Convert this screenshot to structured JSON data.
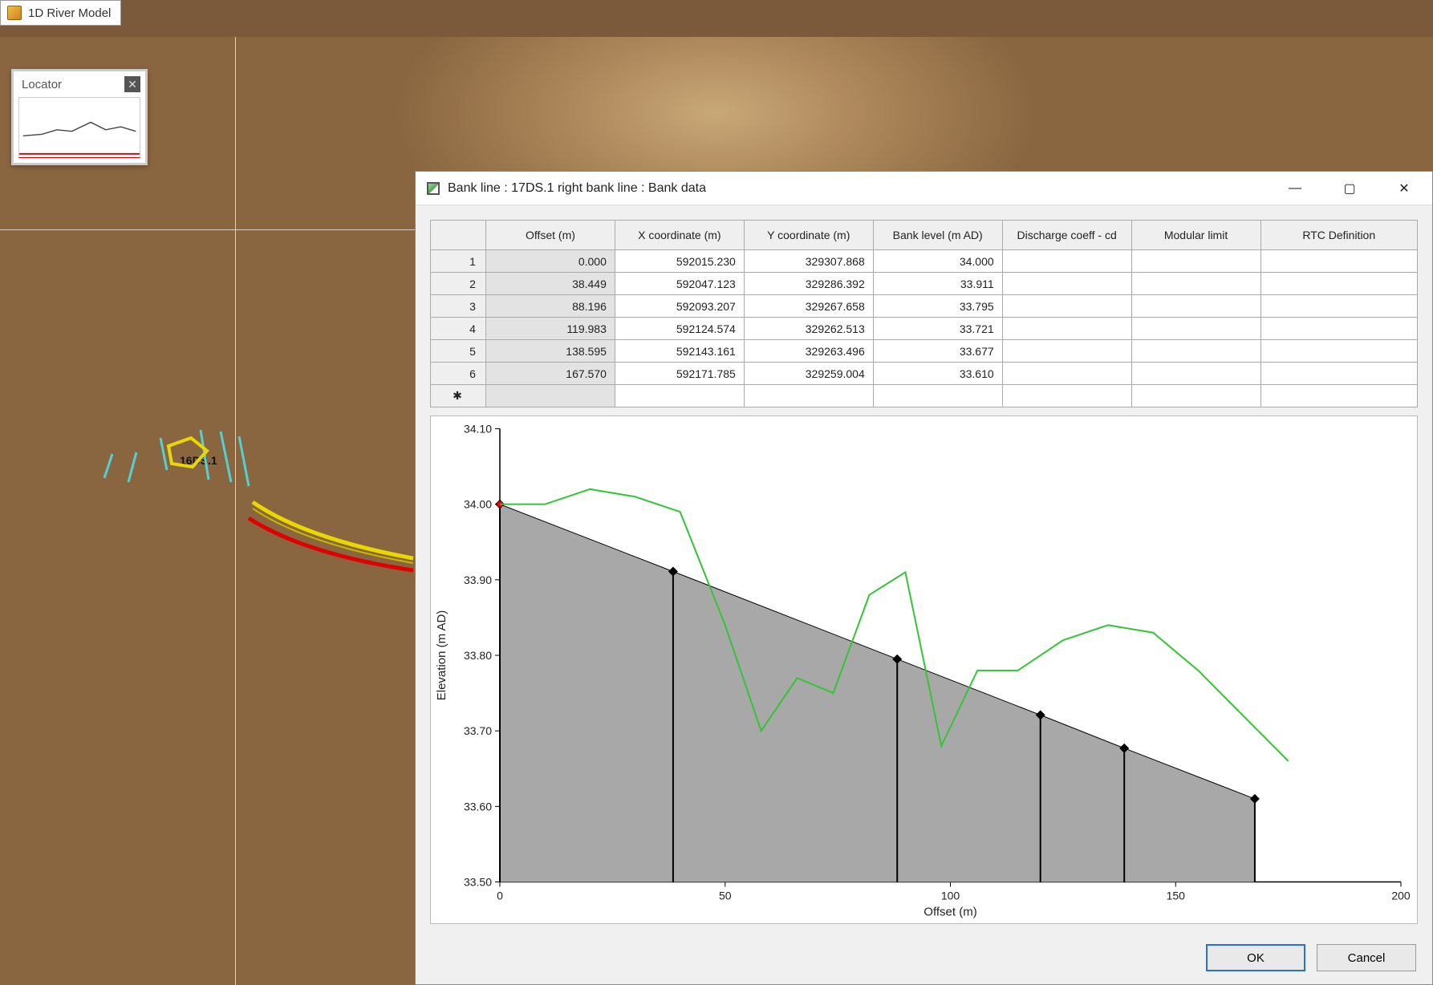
{
  "app": {
    "title": "1D River Model"
  },
  "locator": {
    "title": "Locator"
  },
  "map": {
    "node_label": "16DS.1"
  },
  "dialog": {
    "title": "Bank line : 17DS.1 right bank line : Bank data",
    "ok": "OK",
    "cancel": "Cancel",
    "columns": [
      "Offset (m)",
      "X coordinate (m)",
      "Y coordinate (m)",
      "Bank level (m AD)",
      "Discharge coeff - cd",
      "Modular limit",
      "RTC Definition"
    ],
    "rows": [
      {
        "n": "1",
        "offset": "0.000",
        "x": "592015.230",
        "y": "329307.868",
        "level": "34.000",
        "dc": "",
        "ml": "",
        "rtc": ""
      },
      {
        "n": "2",
        "offset": "38.449",
        "x": "592047.123",
        "y": "329286.392",
        "level": "33.911",
        "dc": "",
        "ml": "",
        "rtc": ""
      },
      {
        "n": "3",
        "offset": "88.196",
        "x": "592093.207",
        "y": "329267.658",
        "level": "33.795",
        "dc": "",
        "ml": "",
        "rtc": ""
      },
      {
        "n": "4",
        "offset": "119.983",
        "x": "592124.574",
        "y": "329262.513",
        "level": "33.721",
        "dc": "",
        "ml": "",
        "rtc": ""
      },
      {
        "n": "5",
        "offset": "138.595",
        "x": "592143.161",
        "y": "329263.496",
        "level": "33.677",
        "dc": "",
        "ml": "",
        "rtc": ""
      },
      {
        "n": "6",
        "offset": "167.570",
        "x": "592171.785",
        "y": "329259.004",
        "level": "33.610",
        "dc": "",
        "ml": "",
        "rtc": ""
      }
    ]
  },
  "chart_data": {
    "type": "line",
    "xlabel": "Offset (m)",
    "ylabel": "Elevation (m AD)",
    "xlim": [
      0,
      200
    ],
    "ylim": [
      33.5,
      34.1
    ],
    "xticks": [
      0,
      50,
      100,
      150,
      200
    ],
    "yticks": [
      33.5,
      33.6,
      33.7,
      33.8,
      33.9,
      34.0,
      34.1
    ],
    "series": [
      {
        "name": "bank_points",
        "style": "black-diamond-stem-area",
        "x": [
          0.0,
          38.449,
          88.196,
          119.983,
          138.595,
          167.57
        ],
        "y": [
          34.0,
          33.911,
          33.795,
          33.721,
          33.677,
          33.61
        ]
      },
      {
        "name": "terrain_profile",
        "style": "green-line",
        "x": [
          0,
          10,
          20,
          30,
          40,
          50,
          58,
          66,
          74,
          82,
          90,
          98,
          106,
          115,
          125,
          135,
          145,
          155,
          165,
          175
        ],
        "y": [
          34.0,
          34.0,
          34.02,
          34.01,
          33.99,
          33.84,
          33.7,
          33.77,
          33.75,
          33.88,
          33.91,
          33.68,
          33.78,
          33.78,
          33.82,
          33.84,
          33.83,
          33.78,
          33.72,
          33.66
        ]
      }
    ]
  }
}
